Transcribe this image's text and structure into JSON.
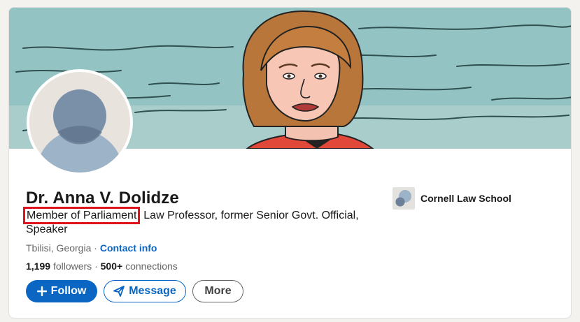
{
  "profile": {
    "name": "Dr. Anna V. Dolidze",
    "headline_first": "Member of Parliament",
    "headline_rest": ", Law Professor, former Senior Govt. Official, Speaker",
    "location": "Tbilisi, Georgia",
    "separator": "·",
    "contact_info": "Contact info",
    "followers_count": "1,199",
    "followers_label": "followers",
    "connections_count": "500+",
    "connections_label": "connections"
  },
  "actions": {
    "follow": "Follow",
    "message": "Message",
    "more": "More"
  },
  "education": {
    "school": "Cornell Law School"
  },
  "colors": {
    "primary": "#0a66c2",
    "banner": "#93c4c3",
    "highlight": "#e0141c"
  }
}
